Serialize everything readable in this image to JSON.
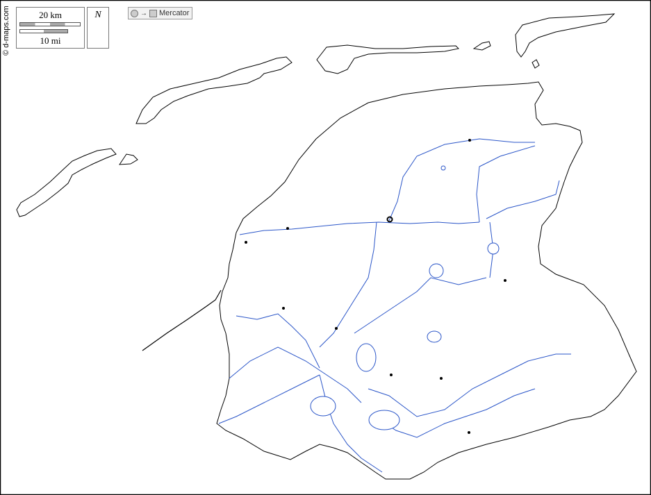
{
  "credit": "© d-maps.com",
  "scale": {
    "km_label": "20 km",
    "mi_label": "10 mi"
  },
  "north": {
    "label": "N"
  },
  "projection": {
    "label": "Mercator",
    "arrow": "→"
  },
  "colors": {
    "land_outline": "#000000",
    "water": "#2a55c8",
    "frame": "#000000"
  },
  "icons": {
    "north_arrow": "compass-rose-icon",
    "capital": "ring-marker",
    "city": "dot-marker"
  },
  "cities": [
    {
      "name": "capital",
      "capital": true
    },
    {
      "name": "city-1"
    },
    {
      "name": "city-2"
    },
    {
      "name": "city-3"
    },
    {
      "name": "city-4"
    },
    {
      "name": "city-5"
    },
    {
      "name": "city-6"
    },
    {
      "name": "city-7"
    },
    {
      "name": "city-8"
    },
    {
      "name": "city-9"
    }
  ]
}
